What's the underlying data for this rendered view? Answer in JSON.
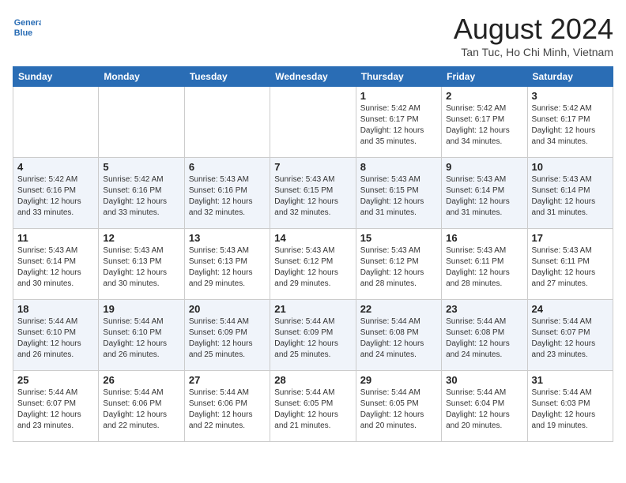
{
  "header": {
    "logo_line1": "General",
    "logo_line2": "Blue",
    "month": "August 2024",
    "location": "Tan Tuc, Ho Chi Minh, Vietnam"
  },
  "weekdays": [
    "Sunday",
    "Monday",
    "Tuesday",
    "Wednesday",
    "Thursday",
    "Friday",
    "Saturday"
  ],
  "weeks": [
    [
      {
        "day": "",
        "info": ""
      },
      {
        "day": "",
        "info": ""
      },
      {
        "day": "",
        "info": ""
      },
      {
        "day": "",
        "info": ""
      },
      {
        "day": "1",
        "info": "Sunrise: 5:42 AM\nSunset: 6:17 PM\nDaylight: 12 hours\nand 35 minutes."
      },
      {
        "day": "2",
        "info": "Sunrise: 5:42 AM\nSunset: 6:17 PM\nDaylight: 12 hours\nand 34 minutes."
      },
      {
        "day": "3",
        "info": "Sunrise: 5:42 AM\nSunset: 6:17 PM\nDaylight: 12 hours\nand 34 minutes."
      }
    ],
    [
      {
        "day": "4",
        "info": "Sunrise: 5:42 AM\nSunset: 6:16 PM\nDaylight: 12 hours\nand 33 minutes."
      },
      {
        "day": "5",
        "info": "Sunrise: 5:42 AM\nSunset: 6:16 PM\nDaylight: 12 hours\nand 33 minutes."
      },
      {
        "day": "6",
        "info": "Sunrise: 5:43 AM\nSunset: 6:16 PM\nDaylight: 12 hours\nand 32 minutes."
      },
      {
        "day": "7",
        "info": "Sunrise: 5:43 AM\nSunset: 6:15 PM\nDaylight: 12 hours\nand 32 minutes."
      },
      {
        "day": "8",
        "info": "Sunrise: 5:43 AM\nSunset: 6:15 PM\nDaylight: 12 hours\nand 31 minutes."
      },
      {
        "day": "9",
        "info": "Sunrise: 5:43 AM\nSunset: 6:14 PM\nDaylight: 12 hours\nand 31 minutes."
      },
      {
        "day": "10",
        "info": "Sunrise: 5:43 AM\nSunset: 6:14 PM\nDaylight: 12 hours\nand 31 minutes."
      }
    ],
    [
      {
        "day": "11",
        "info": "Sunrise: 5:43 AM\nSunset: 6:14 PM\nDaylight: 12 hours\nand 30 minutes."
      },
      {
        "day": "12",
        "info": "Sunrise: 5:43 AM\nSunset: 6:13 PM\nDaylight: 12 hours\nand 30 minutes."
      },
      {
        "day": "13",
        "info": "Sunrise: 5:43 AM\nSunset: 6:13 PM\nDaylight: 12 hours\nand 29 minutes."
      },
      {
        "day": "14",
        "info": "Sunrise: 5:43 AM\nSunset: 6:12 PM\nDaylight: 12 hours\nand 29 minutes."
      },
      {
        "day": "15",
        "info": "Sunrise: 5:43 AM\nSunset: 6:12 PM\nDaylight: 12 hours\nand 28 minutes."
      },
      {
        "day": "16",
        "info": "Sunrise: 5:43 AM\nSunset: 6:11 PM\nDaylight: 12 hours\nand 28 minutes."
      },
      {
        "day": "17",
        "info": "Sunrise: 5:43 AM\nSunset: 6:11 PM\nDaylight: 12 hours\nand 27 minutes."
      }
    ],
    [
      {
        "day": "18",
        "info": "Sunrise: 5:44 AM\nSunset: 6:10 PM\nDaylight: 12 hours\nand 26 minutes."
      },
      {
        "day": "19",
        "info": "Sunrise: 5:44 AM\nSunset: 6:10 PM\nDaylight: 12 hours\nand 26 minutes."
      },
      {
        "day": "20",
        "info": "Sunrise: 5:44 AM\nSunset: 6:09 PM\nDaylight: 12 hours\nand 25 minutes."
      },
      {
        "day": "21",
        "info": "Sunrise: 5:44 AM\nSunset: 6:09 PM\nDaylight: 12 hours\nand 25 minutes."
      },
      {
        "day": "22",
        "info": "Sunrise: 5:44 AM\nSunset: 6:08 PM\nDaylight: 12 hours\nand 24 minutes."
      },
      {
        "day": "23",
        "info": "Sunrise: 5:44 AM\nSunset: 6:08 PM\nDaylight: 12 hours\nand 24 minutes."
      },
      {
        "day": "24",
        "info": "Sunrise: 5:44 AM\nSunset: 6:07 PM\nDaylight: 12 hours\nand 23 minutes."
      }
    ],
    [
      {
        "day": "25",
        "info": "Sunrise: 5:44 AM\nSunset: 6:07 PM\nDaylight: 12 hours\nand 23 minutes."
      },
      {
        "day": "26",
        "info": "Sunrise: 5:44 AM\nSunset: 6:06 PM\nDaylight: 12 hours\nand 22 minutes."
      },
      {
        "day": "27",
        "info": "Sunrise: 5:44 AM\nSunset: 6:06 PM\nDaylight: 12 hours\nand 22 minutes."
      },
      {
        "day": "28",
        "info": "Sunrise: 5:44 AM\nSunset: 6:05 PM\nDaylight: 12 hours\nand 21 minutes."
      },
      {
        "day": "29",
        "info": "Sunrise: 5:44 AM\nSunset: 6:05 PM\nDaylight: 12 hours\nand 20 minutes."
      },
      {
        "day": "30",
        "info": "Sunrise: 5:44 AM\nSunset: 6:04 PM\nDaylight: 12 hours\nand 20 minutes."
      },
      {
        "day": "31",
        "info": "Sunrise: 5:44 AM\nSunset: 6:03 PM\nDaylight: 12 hours\nand 19 minutes."
      }
    ]
  ]
}
